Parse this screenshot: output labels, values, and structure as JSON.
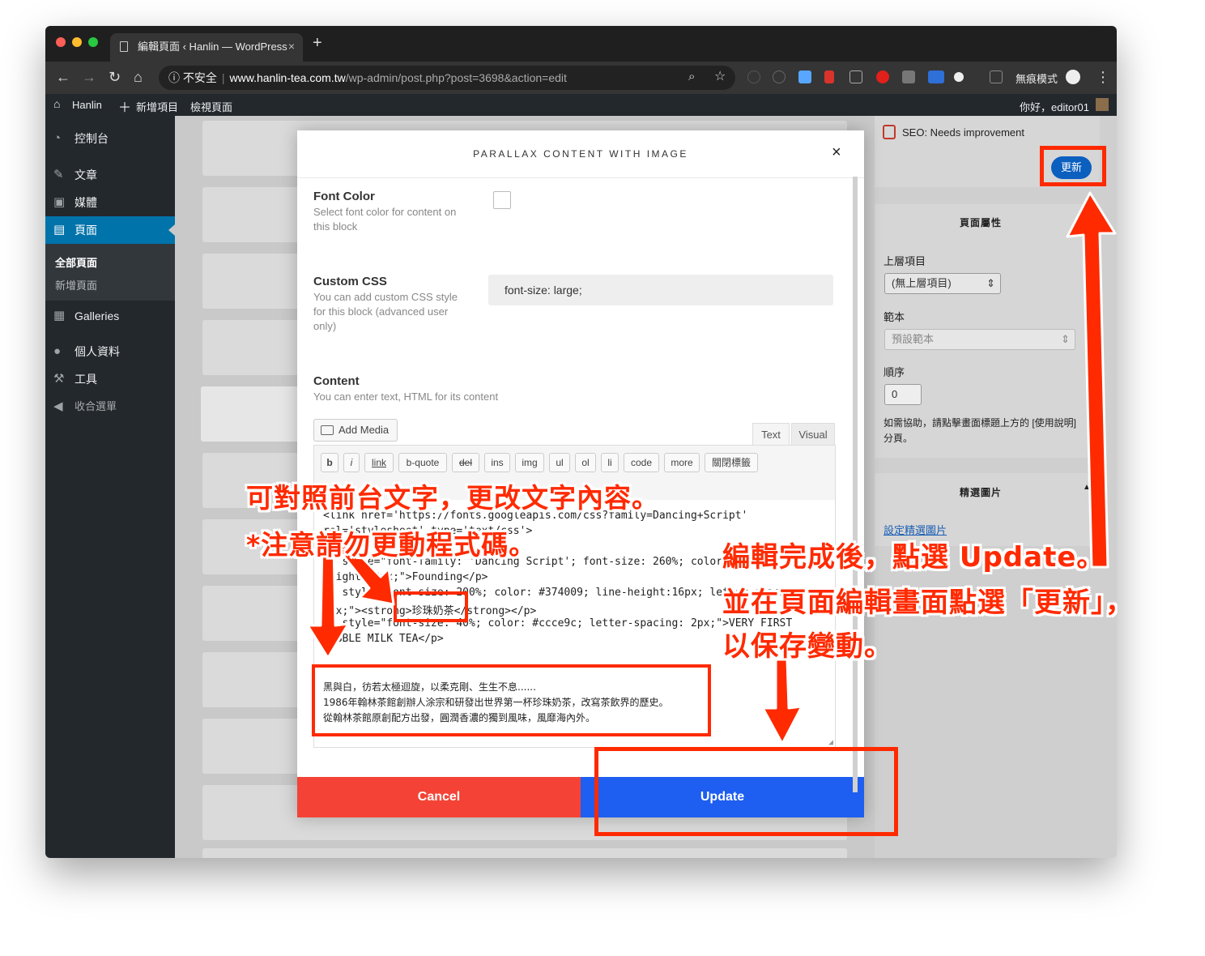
{
  "browser": {
    "tab_title": "編輯頁面 ‹ Hanlin — WordPress",
    "tab_close": "×",
    "new_tab": "+",
    "security_label": "不安全",
    "url_host": "www.hanlin-tea.com.tw",
    "url_path": "/wp-admin/post.php?post=3698&action=edit",
    "incognito_label": "無痕模式"
  },
  "adminbar": {
    "site": "Hanlin",
    "new_item": "新增項目",
    "view_page": "檢視頁面",
    "greeting": "你好，editor01"
  },
  "sidebar": {
    "items": [
      {
        "label": "控制台",
        "icon": "dashboard-icon"
      },
      {
        "label": "文章",
        "icon": "pin-icon"
      },
      {
        "label": "媒體",
        "icon": "media-icon"
      },
      {
        "label": "頁面",
        "icon": "pages-icon"
      },
      {
        "label": "Galleries",
        "icon": "gallery-icon"
      },
      {
        "label": "個人資料",
        "icon": "user-icon"
      },
      {
        "label": "工具",
        "icon": "wrench-icon"
      },
      {
        "label": "收合選單",
        "icon": "collapse-icon"
      }
    ],
    "submenu": [
      "全部頁面",
      "新增頁面"
    ]
  },
  "right_panel": {
    "seo_status": "SEO: Needs improvement",
    "update_button": "更新",
    "page_attributes_title": "頁面屬性",
    "parent_label": "上層項目",
    "parent_value": "(無上層項目)",
    "template_label": "範本",
    "template_value": "預設範本",
    "order_label": "順序",
    "order_value": "0",
    "help_text": "如需協助，請點擊畫面標題上方的 [使用說明] 分頁。",
    "featured_title": "精選圖片",
    "featured_link": "設定精選圖片"
  },
  "modal": {
    "title": "PARALLAX CONTENT WITH IMAGE",
    "close": "×",
    "font_color_label": "Font Color",
    "font_color_desc": "Select font color for content on this block",
    "custom_css_label": "Custom CSS",
    "custom_css_desc": "You can add custom CSS style for this block (advanced user only)",
    "custom_css_value": "font-size: large;",
    "content_label": "Content",
    "content_desc": "You can enter text, HTML for its content",
    "add_media": "Add Media",
    "tab_text": "Text",
    "tab_visual": "Visual",
    "quicktags": [
      "b",
      "i",
      "link",
      "b-quote",
      "del",
      "ins",
      "img",
      "ul",
      "ol",
      "li",
      "code",
      "more",
      "關閉標籤"
    ],
    "code_lines": [
      "<link href='https://fonts.googleapis.com/css?family=Dancing+Script'",
      "rel='stylesheet' type='text/css'>",
      "<p style=\"font-family: 'Dancing Script'; font-size: 260%; color: #ccce9c; line-",
      "height:40px;\">Founding</p>",
      "<p style=\"font-size: 200%; color: #374009; line-height:16px; letter-spacing:",
      "5px;\"><strong>珍珠奶茶</strong></p>",
      "<p style=\"font-size: 40%; color: #ccce9c; letter-spacing: 2px;\">VERY FIRST",
      "BUBBLE MILK TEA</p>"
    ],
    "body_lines": [
      "黑與白，彷若太極迴旋，以柔克剛、生生不息......",
      "1986年翰林茶館創辦人涂宗和研發出世界第一杯珍珠奶茶，改寫茶飲界的歷史。",
      "從翰林茶館原創配方出發，圓潤香濃的獨到風味，風靡海內外。"
    ],
    "cancel": "Cancel",
    "update": "Update"
  },
  "annotations": {
    "note1": "可對照前台文字，更改文字內容。",
    "note2": "*注意請勿更動程式碼。",
    "note3": "編輯完成後，點選 Update。",
    "note4": "並在頁面編輯畫面點選「更新」，",
    "note5": "以保存變動。"
  },
  "colors": {
    "annotation_red": "#ff2a00",
    "wp_blue": "#0073aa",
    "cancel_red": "#f44336",
    "update_blue": "#1e5ef0"
  }
}
